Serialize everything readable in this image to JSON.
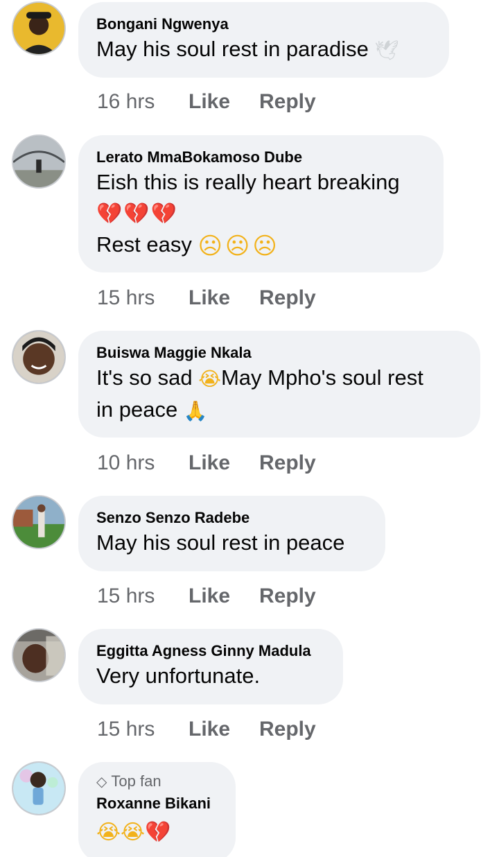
{
  "comments": [
    {
      "author": "Bongani Ngwenya",
      "lines": [
        "May his soul rest in paradise"
      ],
      "emoji_after": [
        "🕊"
      ],
      "time": "16 hrs",
      "like": "Like",
      "reply": "Reply",
      "avatar_icon": "avatar-man-cap"
    },
    {
      "author": "Lerato MmaBokamoso Dube",
      "line1": "Eish this is really heart breaking",
      "line2_emoji": "💔💔💔",
      "line3": "Rest easy",
      "line3_emoji": "☹☹☹",
      "time": "15 hrs",
      "like": "Like",
      "reply": "Reply",
      "avatar_icon": "avatar-bridge"
    },
    {
      "author": "Buiswa Maggie Nkala",
      "line1_a": "It's so sad",
      "line1_emoji": "😭",
      "line1_b": "May Mpho's soul rest",
      "line2": "in peace",
      "line2_emoji": "🙏",
      "time": "10 hrs",
      "like": "Like",
      "reply": "Reply",
      "avatar_icon": "avatar-woman-smile"
    },
    {
      "author": "Senzo Senzo Radebe",
      "line1": "May his soul rest in peace",
      "time": "15 hrs",
      "like": "Like",
      "reply": "Reply",
      "avatar_icon": "avatar-lawn"
    },
    {
      "author": "Eggitta Agness Ginny Madula",
      "line1": "Very unfortunate.",
      "time": "15 hrs",
      "like": "Like",
      "reply": "Reply",
      "avatar_icon": "avatar-selfie"
    },
    {
      "badge": "Top fan",
      "badge_icon": "diamond-icon",
      "author": "Roxanne Bikani",
      "emoji_line": "😭😭💔",
      "avatar_icon": "avatar-cartoon"
    }
  ],
  "colors": {
    "bubble": "#f0f2f5",
    "name": "#050505",
    "meta": "#65676b"
  }
}
